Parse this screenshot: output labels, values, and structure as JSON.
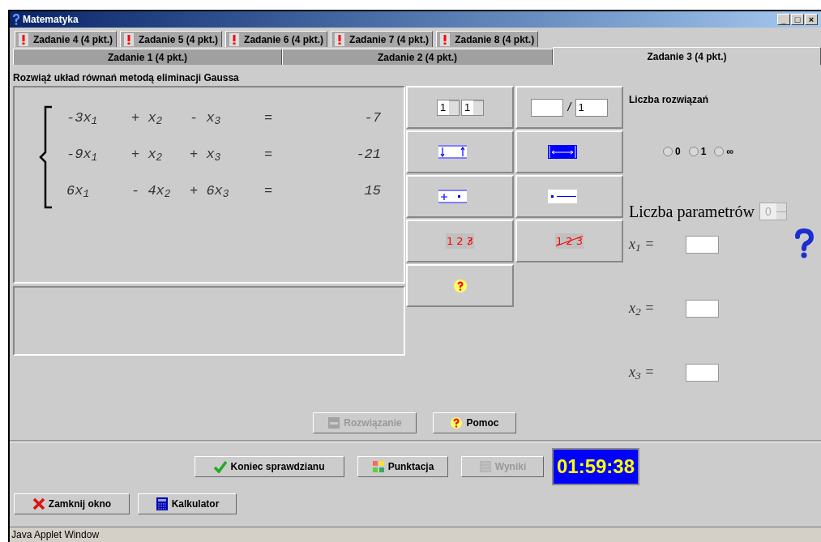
{
  "window": {
    "title": "Matematyka",
    "controls": [
      "_",
      "□",
      "×"
    ]
  },
  "tabs_top": [
    {
      "label": "Zadanie 4 (4 pkt.)",
      "selected": false,
      "warning": true
    },
    {
      "label": "Zadanie 5 (4 pkt.)",
      "selected": false,
      "warning": true
    },
    {
      "label": "Zadanie 6 (4 pkt.)",
      "selected": false,
      "warning": true
    },
    {
      "label": "Zadanie 7 (4 pkt.)",
      "selected": false,
      "warning": true
    },
    {
      "label": "Zadanie 8 (4 pkt.)",
      "selected": false,
      "warning": true
    }
  ],
  "tabs_bottom": [
    {
      "label": "Zadanie 1 (4 pkt.)",
      "selected": false
    },
    {
      "label": "Zadanie 2 (4 pkt.)",
      "selected": false
    },
    {
      "label": "Zadanie 3 (4 pkt.)",
      "selected": true
    }
  ],
  "instruction": "Rozwiąż układ równań metodą eliminacji Gaussa",
  "equations": [
    [
      "-3x$_{1}$",
      "+ x$_{2}$",
      "- x$_{3}$",
      "=",
      "-7"
    ],
    [
      "-9x$_{1}$",
      "+ x$_{2}$",
      "+ x$_{3}$",
      "=",
      "-21"
    ],
    [
      "6x$_{1}$",
      "- 4x$_{2}$",
      "+ 6x$_{3}$",
      "=",
      "15"
    ]
  ],
  "tools": [
    {
      "kind": "spinners",
      "values": [
        "1",
        "1"
      ]
    },
    {
      "kind": "fraction",
      "separator": "/",
      "denominator": "1"
    },
    {
      "kind": "swap"
    },
    {
      "kind": "span"
    },
    {
      "kind": "add"
    },
    {
      "kind": "point-line"
    },
    {
      "kind": "strike-last",
      "text": "1 2 3"
    },
    {
      "kind": "strike-all",
      "text": "1 2 3"
    },
    {
      "kind": "hint"
    }
  ],
  "solutions": {
    "label": "Liczba rozwiązań",
    "options": [
      {
        "label": "0",
        "selected": false
      },
      {
        "label": "1",
        "selected": false
      },
      {
        "label": "∞",
        "selected": false
      }
    ]
  },
  "parameters": {
    "label": "Liczba parametrów",
    "value": "0",
    "disabled": true
  },
  "unknowns": [
    {
      "label": "x$_{1}$ ="
    },
    {
      "label": "x$_{2}$ ="
    },
    {
      "label": "x$_{3}$ ="
    }
  ],
  "task_buttons": [
    {
      "label": "Rozwiązanie",
      "disabled": true,
      "kind": "solution"
    },
    {
      "label": "Pomoc",
      "disabled": false,
      "kind": "help"
    }
  ],
  "main_buttons": [
    {
      "label": "Koniec sprawdzianu",
      "disabled": false,
      "kind": "check"
    },
    {
      "label": "Punktacja",
      "disabled": false,
      "kind": "score"
    },
    {
      "label": "Wyniki",
      "disabled": true,
      "kind": "results"
    }
  ],
  "timer": "01:59:38",
  "footer_buttons": [
    {
      "label": "Zamknij okno",
      "disabled": false,
      "kind": "close"
    },
    {
      "label": "Kalkulator",
      "disabled": false,
      "kind": "calc"
    }
  ],
  "status_bar": "Java Applet Window"
}
